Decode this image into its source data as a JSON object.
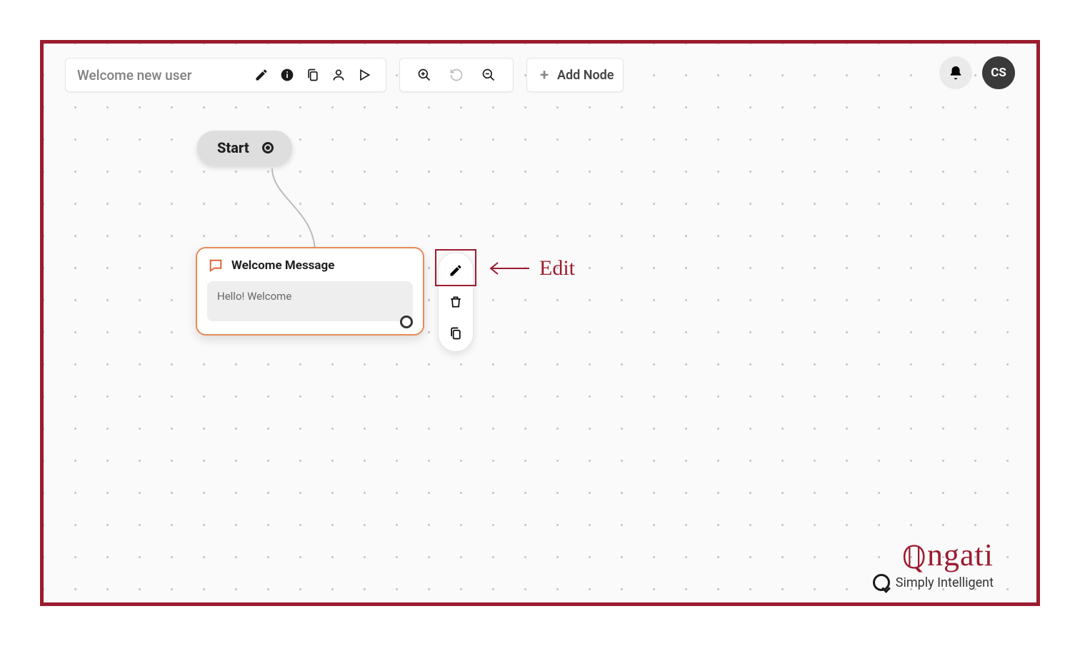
{
  "toolbar": {
    "flow_title": "Welcome new user",
    "add_node_label": "Add Node"
  },
  "header": {
    "avatar_initials": "CS"
  },
  "start_node": {
    "label": "Start"
  },
  "message_node": {
    "title": "Welcome Message",
    "body": "Hello! Welcome"
  },
  "annotation": {
    "edit_label": "Edit"
  },
  "logo": {
    "brand": "engati",
    "tagline": "Simply Intelligent"
  }
}
